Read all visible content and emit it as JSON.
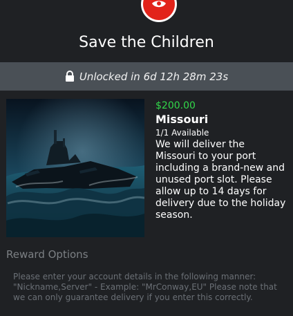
{
  "header": {
    "logo_icon": "save-the-children-logo",
    "logo_color": "#e2231a",
    "title": "Save the Children"
  },
  "unlock": {
    "icon": "lock-icon",
    "text": "Unlocked in 6d 12h 28m 23s",
    "bar_color": "#4a5056"
  },
  "reward": {
    "image": "Missouri battleship in stormy sea",
    "price": "$200.00",
    "price_color": "#32d84a",
    "name": "Missouri",
    "availability": "1/1 Available",
    "description": "We will deliver the Missouri to your port including a brand-new and unused port slot. Please allow up to 14 days for delivery due to the holiday season."
  },
  "options": {
    "heading": "Reward Options",
    "instructions": "Please enter your account details in the following manner: \"Nickname,Server\" - Example: \"MrConway,EU\" Please note that we can only guarantee delivery if you enter this correctly."
  }
}
